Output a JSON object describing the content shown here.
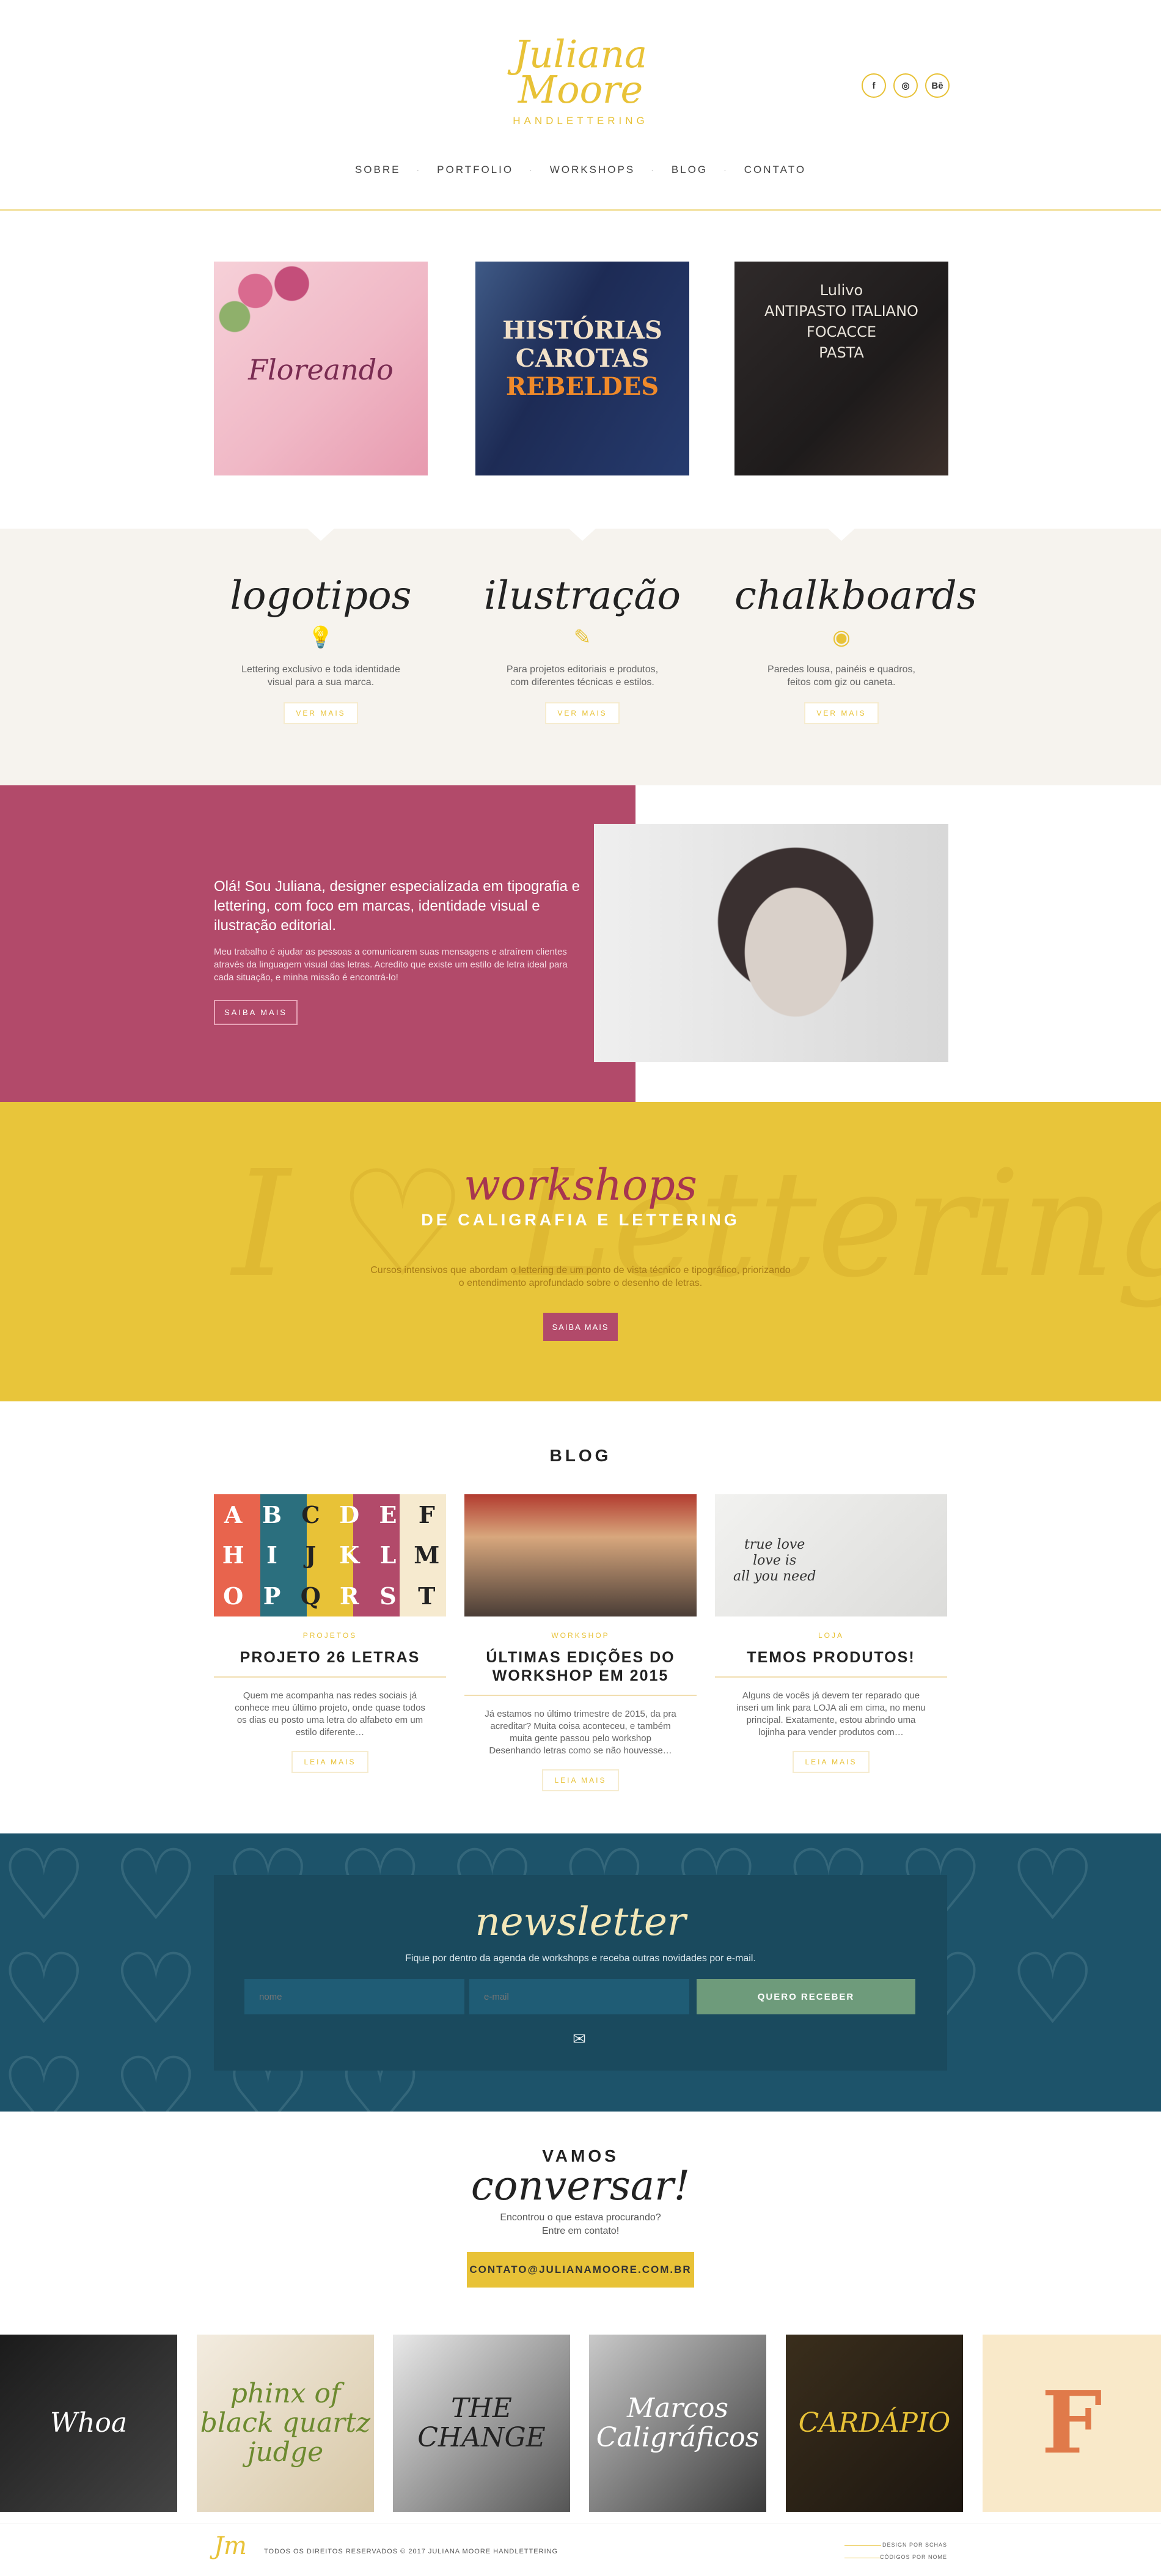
{
  "header": {
    "logo_line1": "Juliana",
    "logo_line2": "Moore",
    "logo_sub": "HANDLETTERING",
    "social": [
      "f",
      "◎",
      "Bē"
    ],
    "nav": [
      "SOBRE",
      "PORTFOLIO",
      "WORKSHOPS",
      "BLOG",
      "CONTATO"
    ]
  },
  "portfolio": {
    "t1": "Floreando",
    "t2_line1": "HISTÓRIAS",
    "t2_line2": "CAROTAS",
    "t2_line3": "REBELDES",
    "t3_line1": "Lulivo",
    "t3_line2": "ANTIPASTO ITALIANO",
    "t3_line3": "FOCACCE",
    "t3_line4": "PASTA"
  },
  "services": [
    {
      "title": "logotipos",
      "icon": "lightbulb-icon",
      "glyph": "💡",
      "text_1": "Lettering exclusivo e toda identidade",
      "text_2": "visual para a sua marca.",
      "button": "VER MAIS"
    },
    {
      "title": "ilustração",
      "icon": "pencil-icon",
      "glyph": "✎",
      "text_1": "Para projetos editoriais e produtos,",
      "text_2": "com diferentes técnicas e estilos.",
      "button": "VER MAIS"
    },
    {
      "title": "chalkboards",
      "icon": "eye-icon",
      "glyph": "◉",
      "text_1": "Paredes lousa, painéis e quadros,",
      "text_2": "feitos com giz ou caneta.",
      "button": "VER MAIS"
    }
  ],
  "about": {
    "lead": "Olá! Sou Juliana, designer especializada em tipografia e lettering, com foco em marcas, identidade visual e ilustração editorial.",
    "body": "Meu trabalho é ajudar as pessoas a comunicarem suas mensagens e atraírem clientes através da linguagem visual das letras. Acredito que existe um estilo de letra ideal para cada situação, e minha missão é encontrá-lo!",
    "button": "SAIBA MAIS"
  },
  "workshops": {
    "bg_text": "I ♡ Lettering",
    "title": "workshops",
    "subtitle": "DE CALIGRAFIA E LETTERING",
    "desc": "Cursos intensivos que abordam o lettering de um ponto de vista técnico e tipográfico, priorizando o entendimento aprofundado sobre o desenho de letras.",
    "button": "SAIBA MAIS"
  },
  "blog": {
    "title": "BLOG",
    "letters": [
      "A",
      "B",
      "C",
      "D",
      "E",
      "F",
      "H",
      "I",
      "J",
      "K",
      "L",
      "M",
      "O",
      "P",
      "Q",
      "R",
      "S",
      "T"
    ],
    "mug_line1": "true love",
    "mug_line2": "love is",
    "mug_line3": "all you need",
    "posts": [
      {
        "category": "PROJETOS",
        "title": "PROJETO 26 LETRAS",
        "excerpt": "Quem me acompanha nas redes sociais já conhece meu último projeto, onde quase todos os dias eu posto uma letra do alfabeto em um estilo diferente…",
        "button": "LEIA MAIS"
      },
      {
        "category": "WORKSHOP",
        "title": "ÚLTIMAS EDIÇÕES DO WORKSHOP EM 2015",
        "excerpt": "Já estamos no último trimestre de 2015, da pra acreditar? Muita coisa aconteceu, e também muita gente passou pelo workshop Desenhando letras como se não houvesse…",
        "button": "LEIA MAIS"
      },
      {
        "category": "LOJA",
        "title": "TEMOS PRODUTOS!",
        "excerpt": "Alguns de vocês já devem ter reparado que inseri um link para LOJA ali em cima, no menu principal. Exatamente, estou abrindo uma lojinha para vender produtos com…",
        "button": "LEIA MAIS"
      }
    ]
  },
  "newsletter": {
    "bg_pattern": "♡♡♡♡♡♡♡♡♡♡♡♡♡♡♡♡♡♡♡♡♡♡♡♡",
    "title": "newsletter",
    "subtitle": "Fique por dentro da agenda de workshops e receba outras novidades por e-mail.",
    "name_placeholder": "nome",
    "email_placeholder": "e-mail",
    "button": "QUERO RECEBER",
    "mail_glyph": "✉"
  },
  "contact": {
    "vamos": "VAMOS",
    "conversar": "conversar!",
    "text_line1": "Encontrou o que estava procurando?",
    "text_line2": "Entre em contato!",
    "email": "CONTATO@JULIANAMOORE.COM.BR"
  },
  "instagram": {
    "i1": "Whoa",
    "i2": "phinx of black quartz judge",
    "i3": "THE CHANGE",
    "i4": "Marcos Caligráficos",
    "i5": "CARDÁPIO",
    "i6": "F"
  },
  "footer": {
    "logo": "Jm",
    "copyright": "TODOS OS DIREITOS RESERVADOS © 2017 JULIANA MOORE HANDLETTERING",
    "credit_design": "DESIGN POR SCHAS",
    "credit_code": "CÓDIGOS POR NOME"
  },
  "colors": {
    "yellow": "#e8c237",
    "berry": "#b24a6a",
    "teal": "#1d536a",
    "sage": "#6e9b7b",
    "cream": "#f6f3ee"
  }
}
